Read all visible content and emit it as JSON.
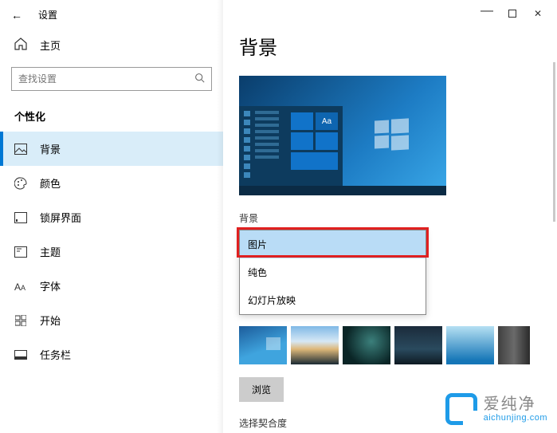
{
  "titlebar": {
    "app_name": "设置"
  },
  "sidebar": {
    "home_label": "主页",
    "search_placeholder": "查找设置",
    "category_label": "个性化",
    "items": [
      {
        "label": "背景",
        "icon": "image-icon",
        "active": true
      },
      {
        "label": "颜色",
        "icon": "palette-icon",
        "active": false
      },
      {
        "label": "锁屏界面",
        "icon": "lockscreen-icon",
        "active": false
      },
      {
        "label": "主题",
        "icon": "theme-icon",
        "active": false
      },
      {
        "label": "字体",
        "icon": "font-icon",
        "active": false
      },
      {
        "label": "开始",
        "icon": "start-icon",
        "active": false
      },
      {
        "label": "任务栏",
        "icon": "taskbar-icon",
        "active": false
      }
    ]
  },
  "main": {
    "page_title": "背景",
    "preview_sample_text": "Aa",
    "bg_section_label": "背景",
    "dropdown": {
      "selected": "图片",
      "options": [
        "图片",
        "纯色",
        "幻灯片放映"
      ]
    },
    "browse_label": "浏览",
    "fit_label": "选择契合度"
  },
  "watermark": {
    "cn": "爱纯净",
    "en": "aichunjing.com"
  },
  "colors": {
    "accent": "#0078d4",
    "highlight_red": "#e02020"
  }
}
